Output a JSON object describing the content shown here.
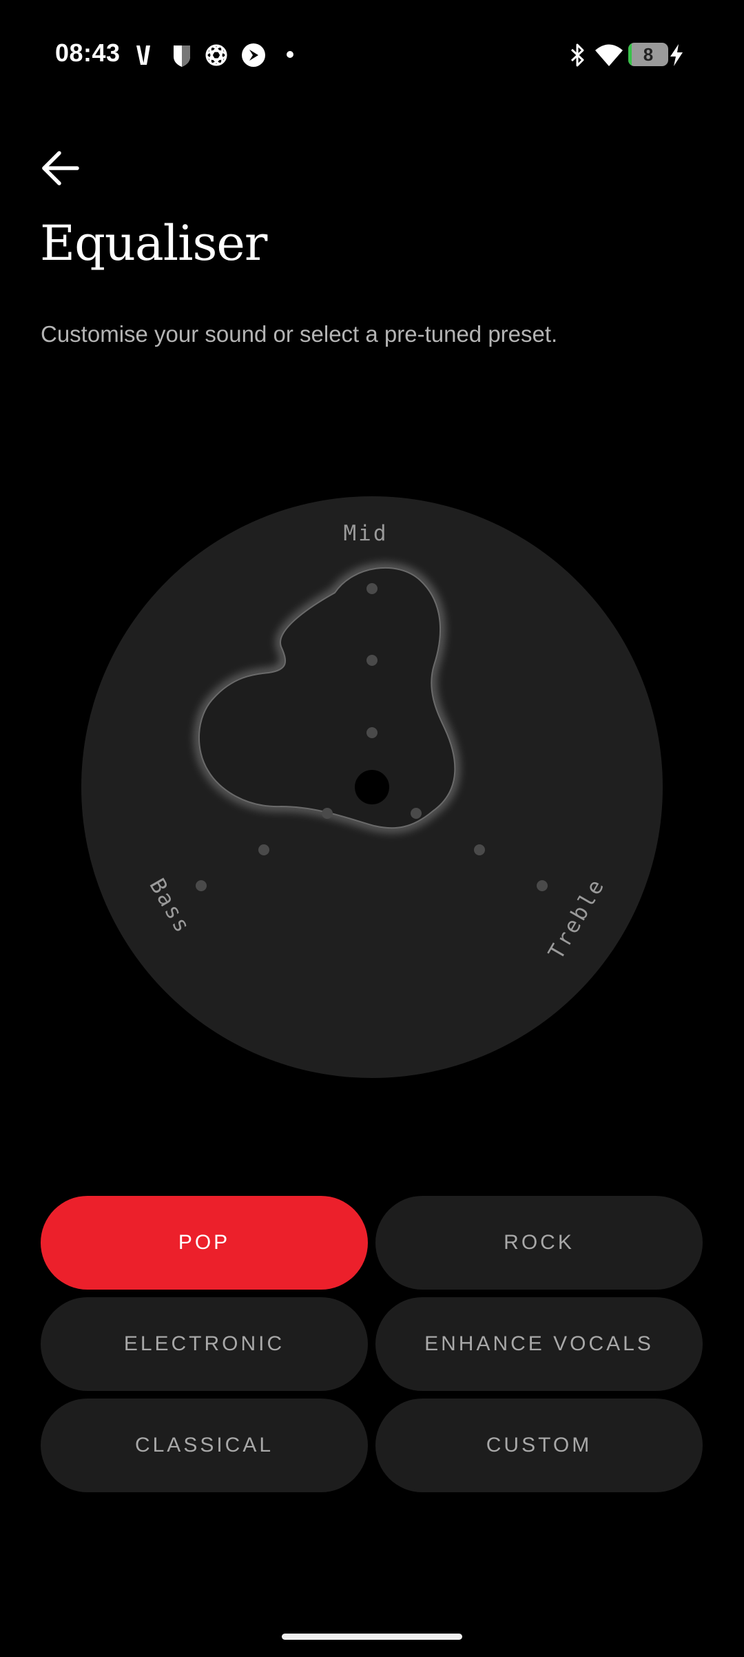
{
  "status_bar": {
    "time": "08:43",
    "battery_level": "8",
    "battery_percent": 8,
    "icons": [
      "v-logo-icon",
      "shield-icon",
      "openai-icon",
      "arrow-circle-icon",
      "notification-dot-icon",
      "bluetooth-icon",
      "wifi-icon",
      "battery-icon",
      "charging-icon"
    ]
  },
  "header": {
    "back_icon": "back-arrow-icon",
    "title": "Equaliser",
    "subtitle": "Customise your sound or select a pre-tuned preset."
  },
  "equaliser": {
    "labels": {
      "mid": "Mid",
      "bass": "Bass",
      "treble": "Treble"
    },
    "selected_preset": "POP"
  },
  "presets": [
    {
      "label": "POP",
      "active": true
    },
    {
      "label": "ROCK",
      "active": false
    },
    {
      "label": "ELECTRONIC",
      "active": false
    },
    {
      "label": "ENHANCE VOCALS",
      "active": false
    },
    {
      "label": "CLASSICAL",
      "active": false
    },
    {
      "label": "CUSTOM",
      "active": false
    }
  ],
  "colors": {
    "background": "#000000",
    "accent": "#ec202b",
    "button_bg": "#1d1d1d",
    "disc_bg": "#1f1f1f"
  }
}
